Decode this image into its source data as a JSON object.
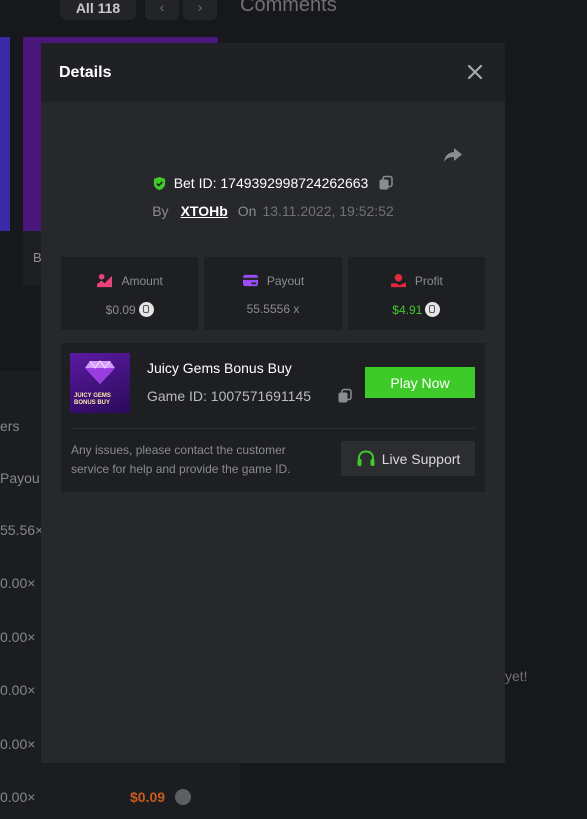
{
  "background": {
    "tab_all": "All 118",
    "nav_prev": "‹",
    "nav_next": "›",
    "comments_heading": "Comments",
    "card_text": "B",
    "col_ers": "ers",
    "col_payout": "Payou",
    "rows": [
      "55.56×",
      "0.00×",
      "0.00×",
      "0.00×",
      "0.00×",
      "0.00×"
    ],
    "row_amount": "$0.09",
    "no_comments_tail": "yet!"
  },
  "modal": {
    "title": "Details",
    "bet_id": "Bet ID: 1749392998724262663",
    "by_label": "By",
    "username": "XTOHb",
    "on_label": "On",
    "date": "13.11.2022, 19:52:52",
    "stats": [
      {
        "label": "Amount",
        "value": "$0.09",
        "icon": "amount-icon",
        "color": "#e8447a"
      },
      {
        "label": "Payout",
        "value": "55.5556 x",
        "icon": "payout-icon",
        "color": "#9b4dff"
      },
      {
        "label": "Profit",
        "value": "$4.91",
        "icon": "profit-icon",
        "color": "#e2283a",
        "value_color": "#3ecb29"
      }
    ],
    "game": {
      "name": "Juicy Gems Bonus Buy",
      "game_id": "Game ID: 1007571691145",
      "thumb_text": "JUICY GEMS BONUS BUY",
      "play_label": "Play Now",
      "help_text": "Any issues, please contact the customer service for help and provide the game ID.",
      "support_label": "Live Support"
    }
  },
  "colors": {
    "accent_green": "#3ecb29",
    "modal_bg": "#27282c",
    "panel_bg": "#1e1f23"
  }
}
